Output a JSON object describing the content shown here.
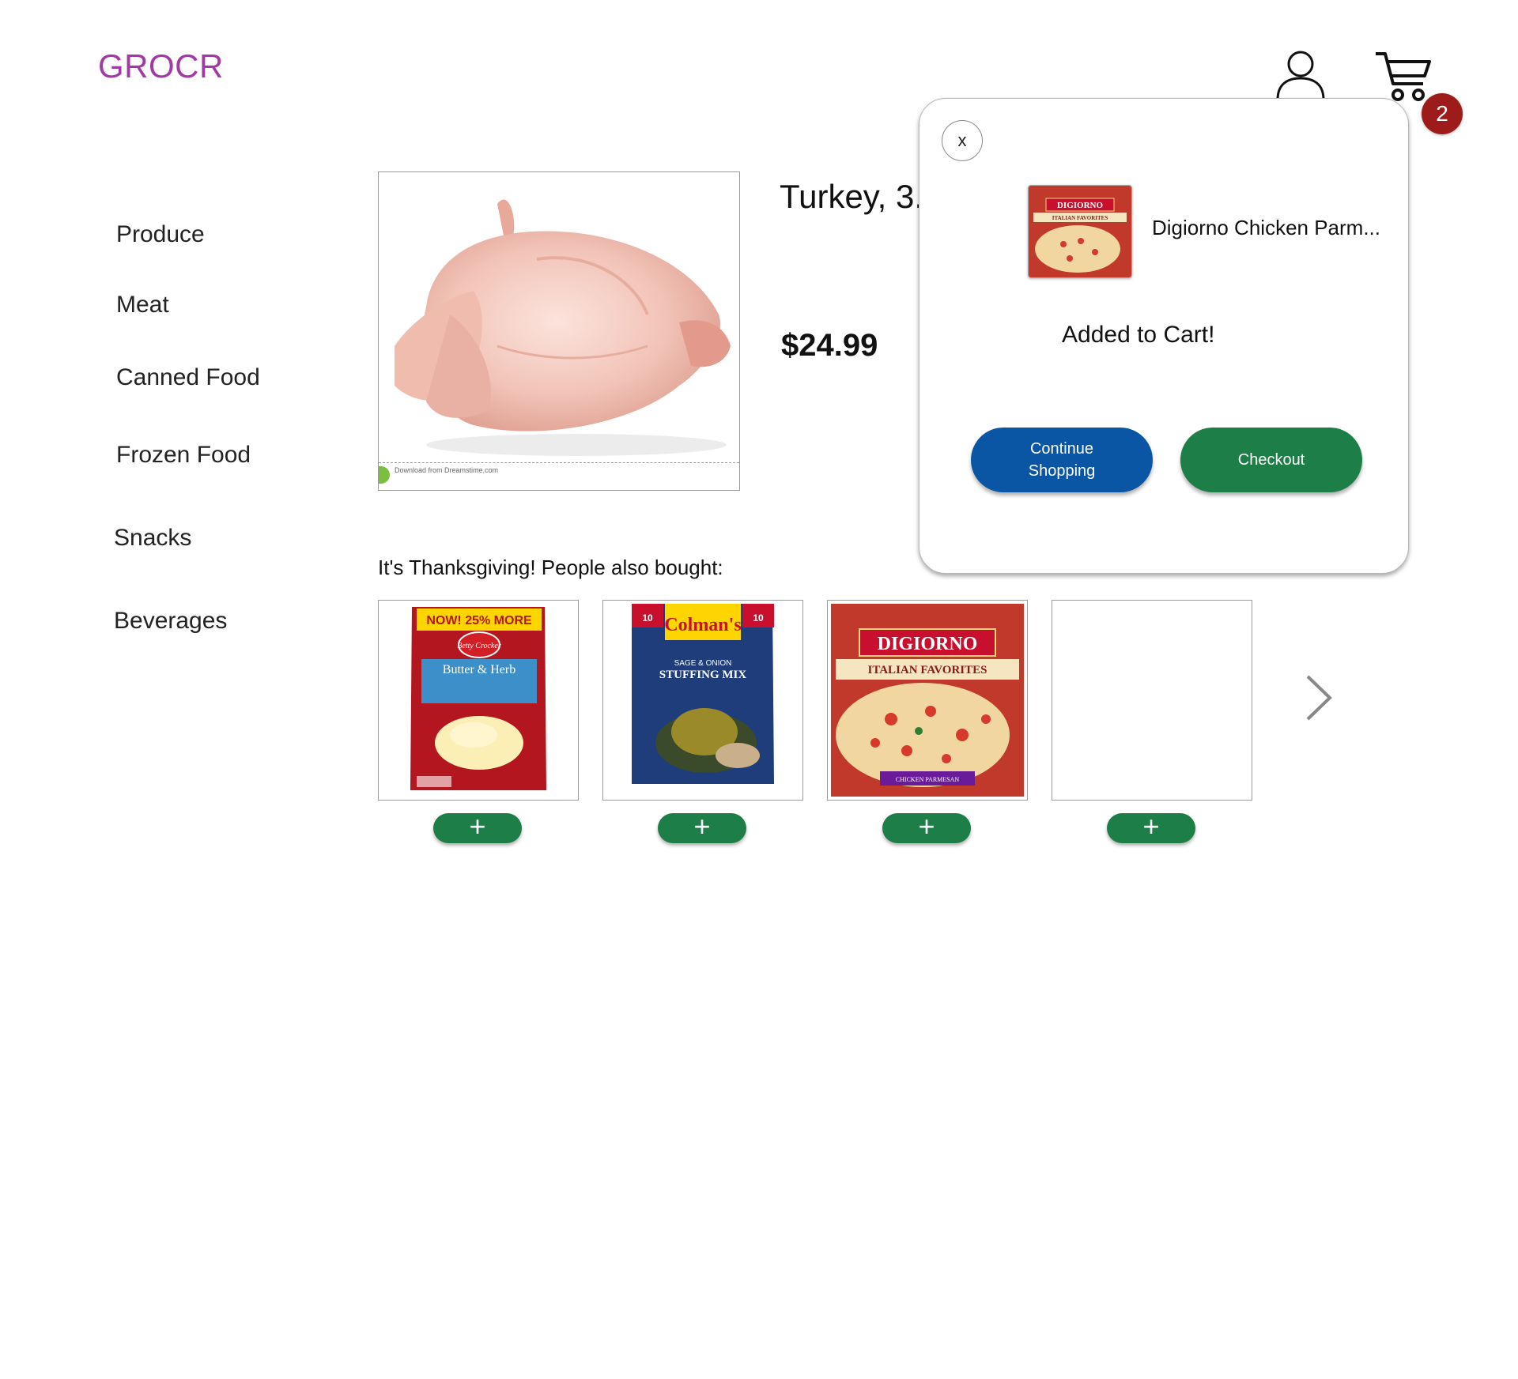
{
  "header": {
    "logo": "GROCR",
    "cart_count": "2",
    "logo_color": "#a23aa6",
    "user_icon": "user-icon",
    "cart_icon": "cart-icon"
  },
  "sidebar": {
    "items": [
      {
        "label": "Produce"
      },
      {
        "label": "Meat"
      },
      {
        "label": "Canned Food"
      },
      {
        "label": "Frozen Food"
      },
      {
        "label": "Snacks"
      },
      {
        "label": "Beverages"
      }
    ]
  },
  "product": {
    "title": "Turkey, 3.",
    "price": "$24.99",
    "image_watermark": "Download from Dreamstime.com"
  },
  "recommendations": {
    "heading": "It's Thanksgiving! People also bought:",
    "add_label": "+",
    "items": [
      {
        "name": "Betty Crocker Butter & Herb",
        "badge": "NOW! 25% MORE",
        "brand": "Betty Crocker",
        "flavor": "Butter & Herb"
      },
      {
        "name": "Colman's Sage & Onion Stuffing Mix",
        "brand": "Colman's",
        "flavor": "SAGE & ONION",
        "product": "STUFFING MIX",
        "serves": "10"
      },
      {
        "name": "Digiorno Italian Favorites Chicken Parmesan",
        "brand": "DIGIORNO",
        "line": "ITALIAN FAVORITES",
        "flavor": "CHICKEN PARMESAN"
      },
      {
        "name": ""
      }
    ],
    "next_icon": "chevron-right-icon"
  },
  "popup": {
    "close_label": "x",
    "item_name": "Digiorno Chicken Parm...",
    "message": "Added to Cart!",
    "continue_label": "Continue Shopping",
    "checkout_label": "Checkout",
    "continue_color": "#0b56a4",
    "checkout_color": "#1e7e48",
    "thumb_brand": "DIGIORNO",
    "thumb_line": "ITALIAN FAVORITES"
  },
  "colors": {
    "badge": "#9e1b1b",
    "add_button": "#1e7e48"
  }
}
